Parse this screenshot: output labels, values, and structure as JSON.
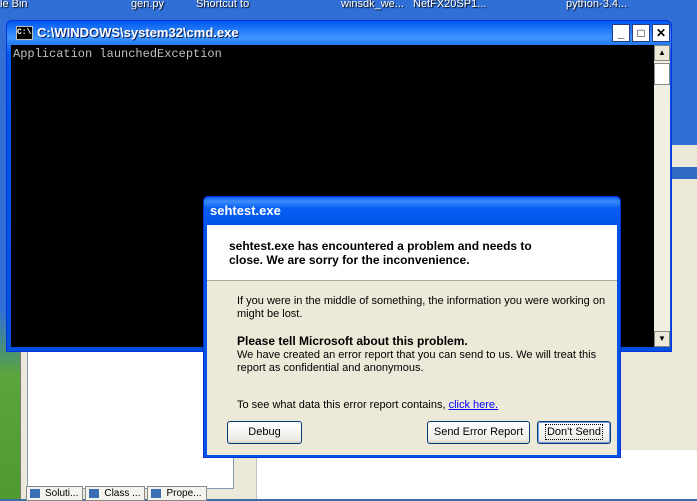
{
  "desktop": {
    "labels": [
      "le Bin",
      "gen.py",
      "Shortcut to",
      "winsdk_we...",
      "NetFX20SP1...",
      "python-3.4..."
    ]
  },
  "cmd": {
    "title": "C:\\WINDOWS\\system32\\cmd.exe",
    "output": "Application launchedException",
    "icon_text": "C:\\",
    "minimize": "_",
    "maximize": "□",
    "close": "✕"
  },
  "dialog": {
    "title": "sehtest.exe",
    "header": "sehtest.exe has encountered a problem and needs to close.  We are sorry for the inconvenience.",
    "p1": "If you were in the middle of something, the information you were working on might be lost.",
    "heading2": "Please tell Microsoft about this problem.",
    "p2": "We have created an error report that you can send to us.  We will treat this report as confidential and anonymous.",
    "p3_prefix": "To see what data this error report contains, ",
    "p3_link": "click here.",
    "buttons": {
      "debug": "Debug",
      "send": "Send Error Report",
      "dont_send": "Don't Send"
    }
  },
  "background_app": {
    "tabs": [
      "Soluti...",
      "Class ...",
      "Prope..."
    ]
  }
}
